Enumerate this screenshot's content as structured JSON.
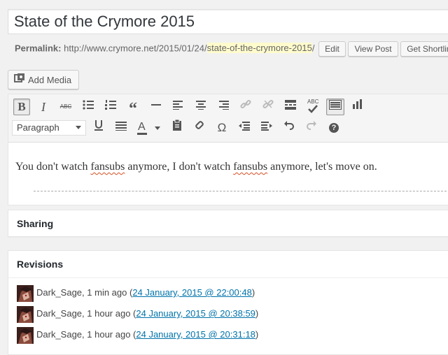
{
  "post": {
    "title": "State of the Crymore 2015",
    "permalink_label": "Permalink:",
    "permalink_base": "http://www.crymore.net/2015/01/24/",
    "permalink_slug": "state-of-the-crymore-2015",
    "permalink_trail": "/",
    "buttons": {
      "edit": "Edit",
      "view": "View Post",
      "shortlink": "Get Shortlink"
    }
  },
  "media": {
    "add_label": "Add Media"
  },
  "toolbar": {
    "format_value": "Paragraph",
    "bold_glyph": "B",
    "italic_glyph": "I",
    "strike_glyph": "ABC",
    "spell_glyph": "ABC",
    "omega_glyph": "Ω",
    "help_glyph": "?"
  },
  "content": {
    "before1": "You don't watch ",
    "word1": "fansubs",
    "between": " anymore, I don't watch ",
    "word2": "fansubs",
    "after": " anymore, let's move on."
  },
  "sharing": {
    "title": "Sharing"
  },
  "revisions": {
    "title": "Revisions",
    "items": [
      {
        "author": "Dark_Sage",
        "when": ", 1 min ago (",
        "link": "24 January, 2015 @ 22:00:48",
        "end": ")"
      },
      {
        "author": "Dark_Sage",
        "when": ", 1 hour ago (",
        "link": "24 January, 2015 @ 20:38:59",
        "end": ")"
      },
      {
        "author": "Dark_Sage",
        "when": ", 1 hour ago (",
        "link": "24 January, 2015 @ 20:31:18",
        "end": ")"
      }
    ]
  },
  "colors": {
    "link": "#0073aa",
    "slug_highlight": "#fffbcc",
    "page_bg": "#f1f1f1"
  }
}
